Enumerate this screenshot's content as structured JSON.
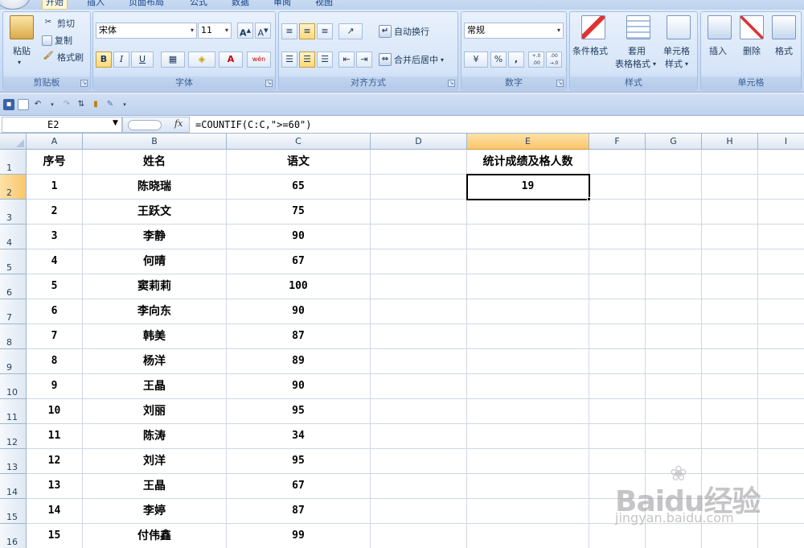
{
  "ribbon": {
    "tabs": [
      {
        "label": "开始",
        "active": true
      },
      {
        "label": "插入"
      },
      {
        "label": "页面布局"
      },
      {
        "label": "公式"
      },
      {
        "label": "数据"
      },
      {
        "label": "审阅"
      },
      {
        "label": "视图"
      }
    ],
    "clipboard": {
      "label": "剪贴板",
      "paste": "粘贴",
      "cut": "剪切",
      "copy": "复制",
      "format_painter": "格式刷"
    },
    "font": {
      "label": "字体",
      "font_name": "宋体",
      "font_size": "11",
      "bold": "B",
      "italic": "I",
      "underline": "U",
      "font_color_letter": "A",
      "phonetic": "wén"
    },
    "alignment": {
      "label": "对齐方式",
      "wrap_text": "自动换行",
      "merge_center": "合并后居中"
    },
    "number": {
      "label": "数字",
      "format": "常规",
      "percent": "%",
      "comma": ",",
      "increase_decimal": "+.0 .00",
      "decrease_decimal": ".00 →.0"
    },
    "styles": {
      "label": "样式",
      "conditional": "条件格式",
      "table_style_line1": "套用",
      "table_style_line2": "表格格式",
      "cell_style_line1": "单元格",
      "cell_style_line2": "样式"
    },
    "cells": {
      "label": "单元格",
      "insert": "插入",
      "delete": "删除",
      "format": "格式"
    }
  },
  "formula_bar": {
    "name_box": "E2",
    "fx": "fx",
    "formula": "=COUNTIF(C:C,\">=60\")"
  },
  "sheet": {
    "columns": [
      "A",
      "B",
      "C",
      "D",
      "E",
      "F",
      "G",
      "H",
      "I"
    ],
    "active_column": "E",
    "active_row": 2,
    "header_row": {
      "A": "序号",
      "B": "姓名",
      "C": "语文",
      "E": "统计成绩及格人数"
    },
    "result": {
      "cell": "E2",
      "value": "19"
    },
    "rows": [
      {
        "row": "2",
        "seq": "1",
        "name": "陈晓瑞",
        "score": "65"
      },
      {
        "row": "3",
        "seq": "2",
        "name": "王跃文",
        "score": "75"
      },
      {
        "row": "4",
        "seq": "3",
        "name": "李静",
        "score": "90"
      },
      {
        "row": "5",
        "seq": "4",
        "name": "何晴",
        "score": "67"
      },
      {
        "row": "6",
        "seq": "5",
        "name": "窦莉莉",
        "score": "100"
      },
      {
        "row": "7",
        "seq": "6",
        "name": "李向东",
        "score": "90"
      },
      {
        "row": "8",
        "seq": "7",
        "name": "韩美",
        "score": "87"
      },
      {
        "row": "9",
        "seq": "8",
        "name": "杨洋",
        "score": "89"
      },
      {
        "row": "10",
        "seq": "9",
        "name": "王晶",
        "score": "90"
      },
      {
        "row": "11",
        "seq": "10",
        "name": "刘丽",
        "score": "95"
      },
      {
        "row": "12",
        "seq": "11",
        "name": "陈涛",
        "score": "34"
      },
      {
        "row": "13",
        "seq": "12",
        "name": "刘洋",
        "score": "95"
      },
      {
        "row": "14",
        "seq": "13",
        "name": "王晶",
        "score": "67"
      },
      {
        "row": "15",
        "seq": "14",
        "name": "李婷",
        "score": "87"
      },
      {
        "row": "16",
        "seq": "15",
        "name": "付伟鑫",
        "score": "99"
      }
    ]
  },
  "watermark": {
    "main": "Baidu经验",
    "sub": "jingyan.baidu.com"
  }
}
